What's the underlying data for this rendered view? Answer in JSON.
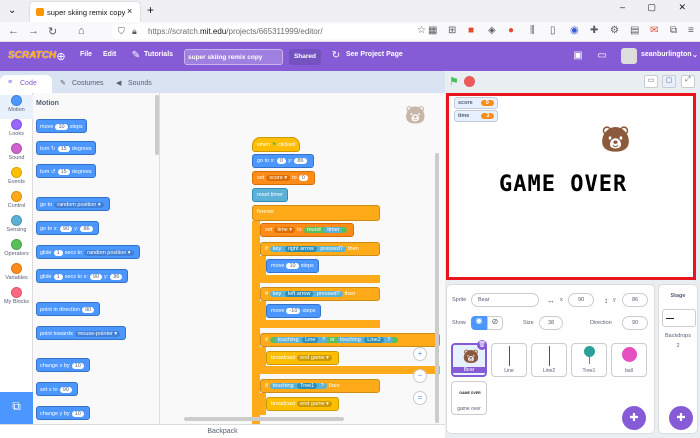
{
  "browser": {
    "tab_title": "super skiing remix copy on",
    "url_prefix": "https://scratch.",
    "url_domain": "mit.edu",
    "url_path": "/projects/665311999/editor/"
  },
  "menubar": {
    "logo": "SCRATCH",
    "file": "File",
    "edit": "Edit",
    "tutorials": "Tutorials",
    "project_title": "super skiing remix copy",
    "shared": "Shared",
    "see_project_page": "See Project Page",
    "username": "seanburlington"
  },
  "editor_tabs": [
    "Code",
    "Costumes",
    "Sounds"
  ],
  "categories": [
    {
      "label": "Motion",
      "color": "#4c97ff"
    },
    {
      "label": "Looks",
      "color": "#9966ff"
    },
    {
      "label": "Sound",
      "color": "#cf63cf"
    },
    {
      "label": "Events",
      "color": "#ffbf00"
    },
    {
      "label": "Control",
      "color": "#ffab19"
    },
    {
      "label": "Sensing",
      "color": "#5cb1d6"
    },
    {
      "label": "Operators",
      "color": "#59c059"
    },
    {
      "label": "Variables",
      "color": "#ff8c1a"
    },
    {
      "label": "My Blocks",
      "color": "#ff6680"
    }
  ],
  "flyout": {
    "heading": "Motion",
    "move": "move",
    "move_val": "10",
    "steps": "steps",
    "turn": "turn",
    "turn_right_val": "15",
    "degrees": "degrees",
    "turn_left_val": "15",
    "goto": "go to",
    "goto_target": "random position",
    "goto_xy": "go to x:",
    "goto_x": "90",
    "y": "y:",
    "goto_y": "86",
    "glide": "glide",
    "glide_val": "1",
    "secs_to": "secs to",
    "glide_target": "random position",
    "glide_xy_val": "1",
    "secs_to_x": "secs to x:",
    "glide_x": "90",
    "glide_y": "86",
    "point_dir": "point in direction",
    "point_dir_val": "90",
    "point_towards": "point towards",
    "point_towards_target": "mouse-pointer",
    "change_x": "change x by",
    "change_x_val": "10",
    "set_x": "set x to",
    "set_x_val": "90",
    "change_y": "change y by",
    "change_y_val": "10"
  },
  "script": {
    "when": "when",
    "clicked": "clicked",
    "goto_xy": "go to x:",
    "x": "0",
    "y_label": "y:",
    "y": "86",
    "set": "set",
    "score_var": "score",
    "to": "to",
    "score_val": "0",
    "reset_timer": "reset timer",
    "forever": "forever",
    "set2": "set",
    "time_var": "time",
    "to2": "to",
    "round": "round",
    "timer": "timer",
    "if1": "if",
    "key1": "key",
    "right_arrow": "right arrow",
    "pressed": "pressed?",
    "then": "then",
    "move1": "move",
    "move1_val": "10",
    "steps1": "steps",
    "if2": "if",
    "key2": "key",
    "left_arrow": "left arrow",
    "pressed2": "pressed?",
    "then2": "then",
    "move2": "move",
    "move2_val": "-10",
    "steps2": "steps",
    "if3": "if",
    "touching": "touching",
    "line": "Line",
    "q": "?",
    "or": "or",
    "touching2": "touching",
    "line2": "Line2",
    "q2": "?",
    "broadcast": "broadcast",
    "end_game": "end game",
    "if4": "if",
    "touching3": "touching",
    "tree1": "Tree1",
    "q3": "?",
    "then4": "then",
    "broadcast2": "broadcast",
    "end_game2": "end game"
  },
  "backpack": "Backpack",
  "stage": {
    "score_label": "score",
    "score_val": "0",
    "time_label": "time",
    "time_val": "3",
    "game_over": "GAME OVER"
  },
  "sprite_info": {
    "sprite_label": "Sprite",
    "sprite_name": "Bear",
    "x_label": "x",
    "x_val": "90",
    "y_label": "y",
    "y_val": "86",
    "show_label": "Show",
    "size_label": "Size",
    "size_val": "38",
    "direction_label": "Direction",
    "direction_val": "90"
  },
  "sprites": [
    {
      "name": "Bear",
      "color": "#8b5a3c"
    },
    {
      "name": "Line",
      "color": "#e8141e"
    },
    {
      "name": "Line2",
      "color": "#e8141e"
    },
    {
      "name": "Tree1",
      "color": "#2aa198"
    },
    {
      "name": "ball",
      "color": "#e64fbf"
    },
    {
      "name": "game over",
      "color": "#222222"
    }
  ],
  "game_over_thumb": "GAME OVER",
  "stage_panel": {
    "title": "Stage",
    "backdrops_label": "Backdrops",
    "backdrops_count": "2"
  }
}
